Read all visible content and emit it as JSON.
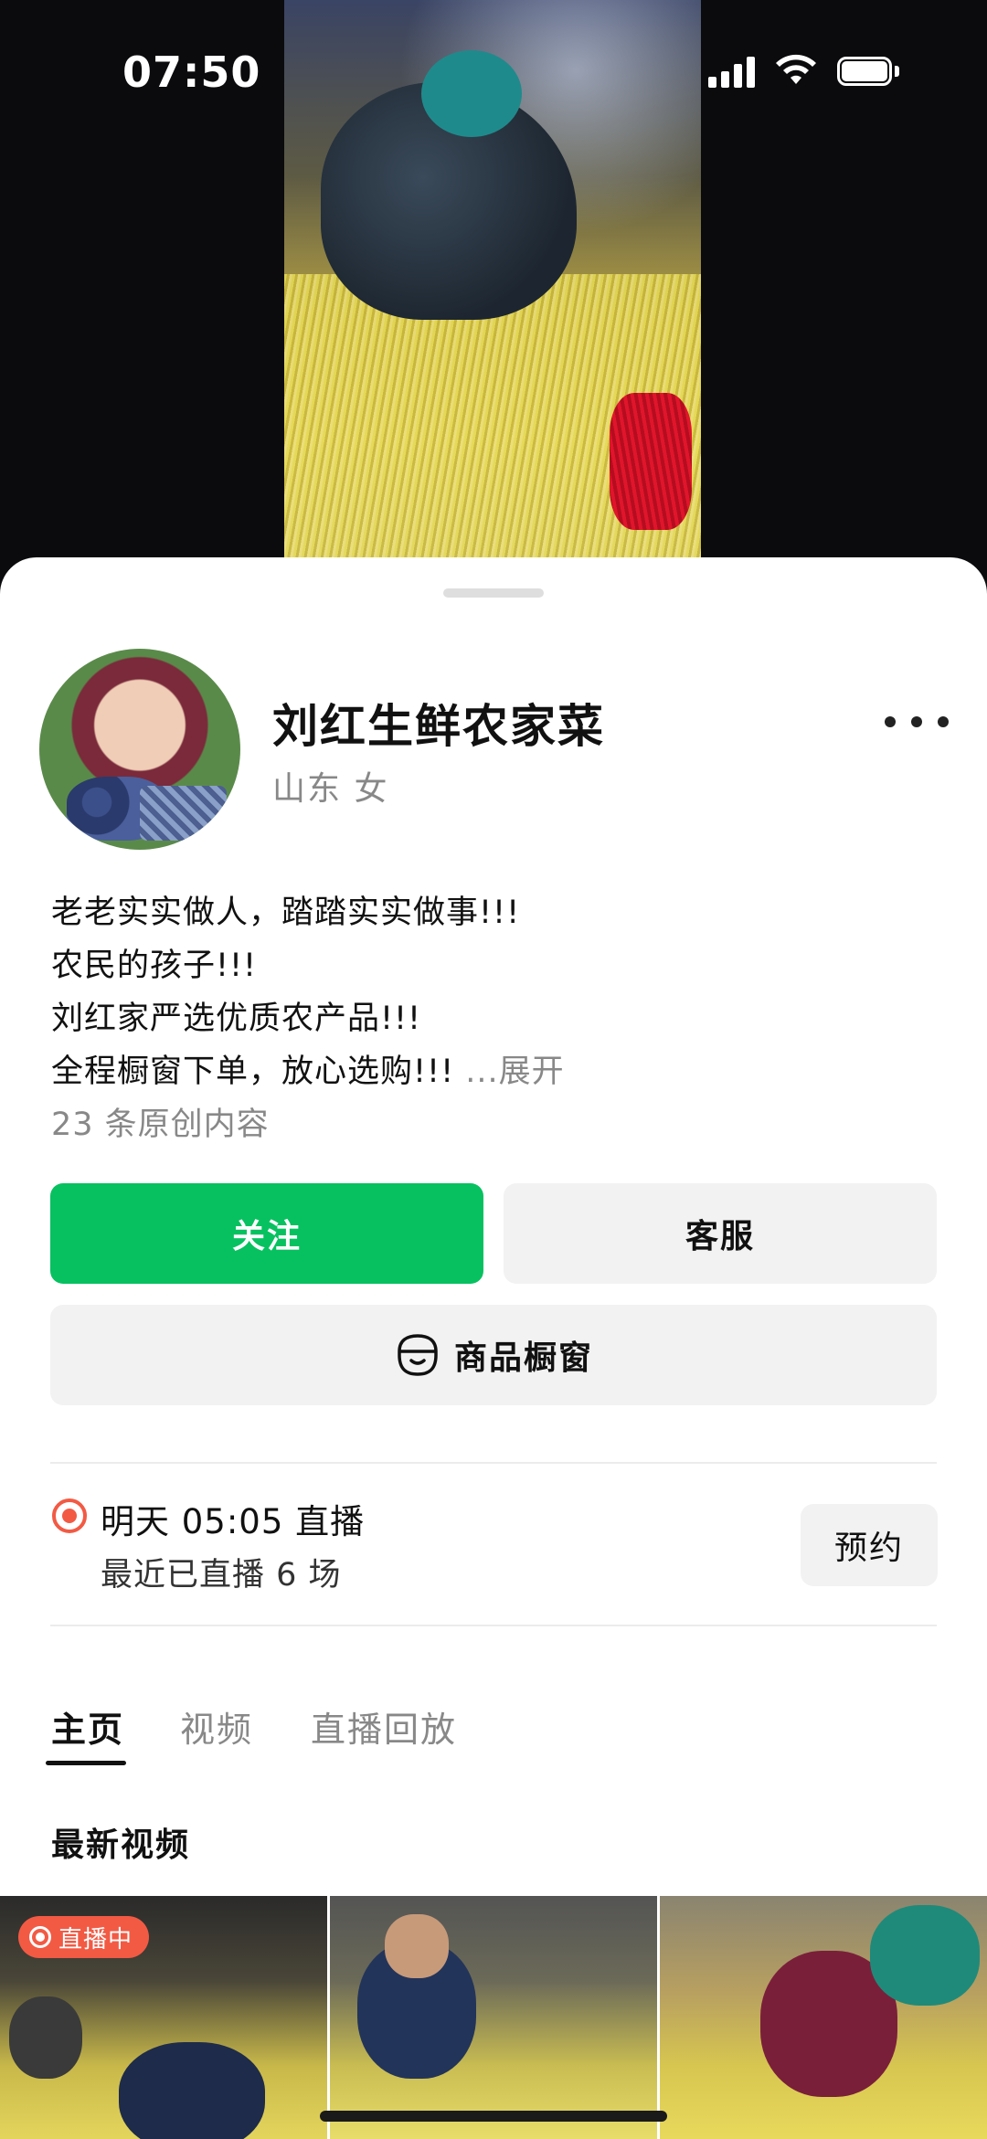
{
  "status_bar": {
    "time": "07:50"
  },
  "profile": {
    "name": "刘红生鲜农家菜",
    "meta": "山东 女",
    "bio_lines": [
      "老老实实做人，踏踏实实做事!!!",
      "农民的孩子!!!",
      "刘红家严选优质农产品!!!",
      "全程橱窗下单，放心选购!!!"
    ],
    "expand_label": "...展开",
    "original_count": "23 条原创内容"
  },
  "actions": {
    "follow_label": "关注",
    "service_label": "客服",
    "shop_label": "商品橱窗"
  },
  "live": {
    "title": "明天 05:05 直播",
    "subtitle": "最近已直播 6 场",
    "reserve_label": "预约"
  },
  "tabs": [
    {
      "label": "主页",
      "active": true
    },
    {
      "label": "视频",
      "active": false
    },
    {
      "label": "直播回放",
      "active": false
    }
  ],
  "section_title": "最新视频",
  "thumbnails": [
    {
      "badge": "直播中"
    },
    {
      "badge": ""
    },
    {
      "badge": ""
    }
  ],
  "colors": {
    "accent_green": "#07c160",
    "live_red": "#f25a44",
    "muted_text": "#888888"
  }
}
